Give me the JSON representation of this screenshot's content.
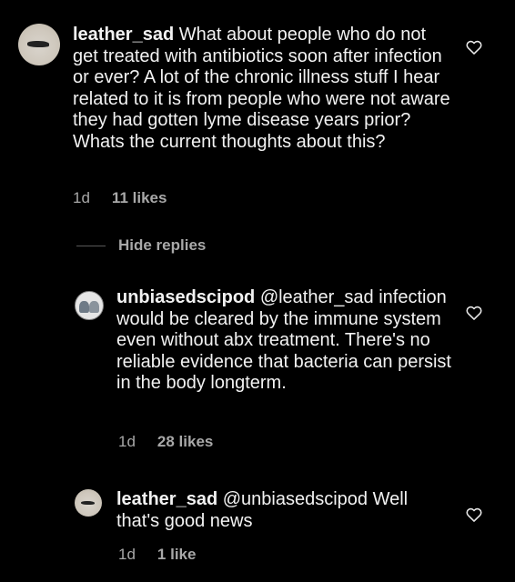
{
  "comments": [
    {
      "username": "leather_sad",
      "text": "What about people who do not get treated with antibiotics soon after infection or ever? A lot of the chronic illness stuff I hear related to it is from people who were not aware they had gotten lyme disease years prior? Whats the current thoughts about this?",
      "time": "1d",
      "likes": "11 likes"
    }
  ],
  "hide_replies_label": "Hide replies",
  "replies": [
    {
      "username": "unbiasedscipod",
      "text": "@leather_sad infection would be cleared by the immune system even without abx treatment. There's no reliable evidence that bacteria can persist in the body longterm.",
      "time": "1d",
      "likes": "28 likes"
    },
    {
      "username": "leather_sad",
      "text": "@unbiasedscipod Well that's good news",
      "time": "1d",
      "likes": "1 like"
    }
  ],
  "icons": {
    "like": "heart-outline-icon"
  },
  "colors": {
    "background": "#000000",
    "text": "#f2f2f2",
    "meta": "#a8a8a8"
  }
}
